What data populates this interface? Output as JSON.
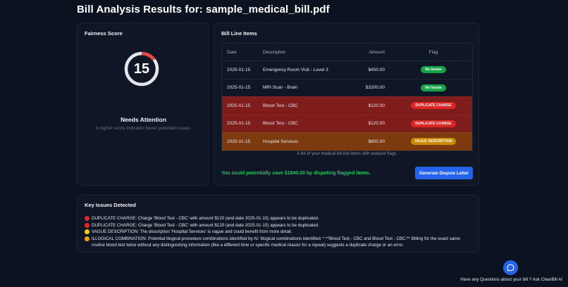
{
  "page": {
    "title": "Bill Analysis Results for: sample_medical_bill.pdf"
  },
  "fairness": {
    "title": "Fairness Score",
    "score": "15",
    "score_fraction": 0.15,
    "label": "Needs Attention",
    "hint": "A higher score indicates fewer potential issues.",
    "colors": {
      "track": "#e5e7eb",
      "arc": "#ef4444"
    }
  },
  "line_items": {
    "title": "Bill Line Items",
    "columns": [
      "Date",
      "Description",
      "Amount",
      "Flag"
    ],
    "rows": [
      {
        "date": "2025-01-15",
        "description": "Emergency Room Visit - Level 3",
        "amount": "$450.00",
        "flag": "No Issues",
        "status": "ok"
      },
      {
        "date": "2025-01-15",
        "description": "MRI Scan - Brain",
        "amount": "$3200.00",
        "flag": "No Issues",
        "status": "ok"
      },
      {
        "date": "2025-01-15",
        "description": "Blood Test - CBC",
        "amount": "$120.00",
        "flag": "DUPLICATE CHARGE",
        "status": "red"
      },
      {
        "date": "2025-01-15",
        "description": "Blood Test - CBC",
        "amount": "$120.00",
        "flag": "DUPLICATE CHARGE",
        "status": "red"
      },
      {
        "date": "2025-01-15",
        "description": "Hospital Services",
        "amount": "$800.00",
        "flag": "VAGUE DESCRIPTION",
        "status": "orange"
      }
    ],
    "caption": "A list of your medical bill line items with analysis flags.",
    "savings": "You could potentially save $1040.00 by disputing flagged items.",
    "dispute_button": "Generate Dispute Letter"
  },
  "issues": {
    "title": "Key Issues Detected",
    "items": [
      {
        "icon": "red-circle-icon",
        "color": "#dc2626",
        "label": "DUPLICATE CHARGE:",
        "text": "Charge 'Blood Test - CBC' with amount $120 (and date 2025-01-15) appears to be duplicated."
      },
      {
        "icon": "red-circle-icon",
        "color": "#dc2626",
        "label": "DUPLICATE CHARGE:",
        "text": "Charge 'Blood Test - CBC' with amount $120 (and date 2025-01-15) appears to be duplicated."
      },
      {
        "icon": "yellow-circle-icon",
        "color": "#facc15",
        "label": "VAGUE DESCRIPTION:",
        "text": "The description 'Hospital Services' is vague and could benefit from more detail."
      },
      {
        "icon": "orange-circle-icon",
        "color": "#f59e0b",
        "label": "ILLOGICAL COMBINATION:",
        "text": "Potential illogical procedure combinations identified by AI: Illogical combinations identified: * **Blood Test - CBC and Blood Test - CBC:** Billing for the exact same routine blood test twice without any distinguishing information (like a different time or specific medical reason for a repeat) suggests a duplicate charge or an error."
      }
    ]
  },
  "footer": {
    "chat_icon": "chat-bubble-icon",
    "ask_text": "Have any Questions about your bill ? Ask ClearBill AI"
  }
}
